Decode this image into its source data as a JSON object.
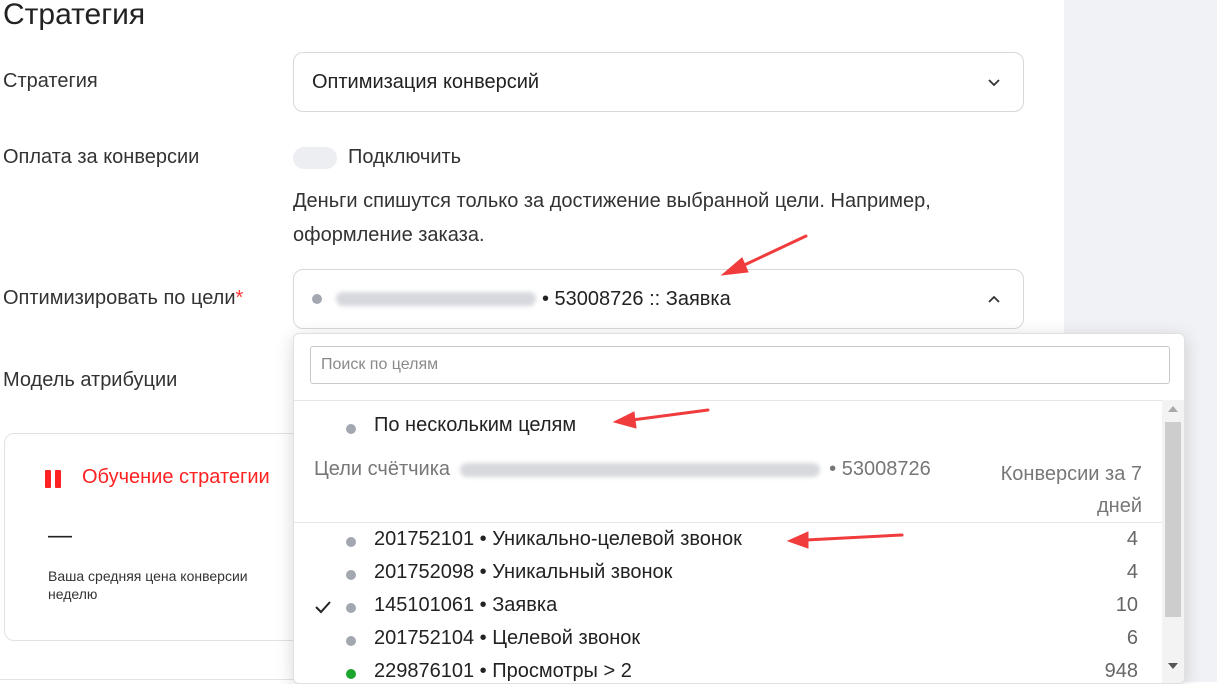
{
  "page_title": "Стратегия",
  "strategy": {
    "label": "Стратегия",
    "value": "Оптимизация конверсий"
  },
  "conversion_payment": {
    "label": "Оплата за конверсии",
    "toggle_label": "Подключить",
    "hint": "Деньги спишутся только за достижение выбранной цели. Например, оформление заказа."
  },
  "goal_select": {
    "label": "Оптимизировать по цели",
    "required_mark": "*",
    "selected_suffix": "• 53008726 :: Заявка"
  },
  "attribution": {
    "label": "Модель атрибуции"
  },
  "training": {
    "title": "Обучение стратегии",
    "dash": "—",
    "note": "Ваша средняя цена конверсии неделю"
  },
  "dropdown": {
    "search_placeholder": "Поиск по целям",
    "multi_goals": "По нескольким целям",
    "group_header_prefix": "Цели счётчика",
    "group_header_id": "• 53008726",
    "conversions_header": "Конверсии за 7 дней",
    "items": [
      {
        "text": "201752101 • Уникально-целевой звонок",
        "count": "4",
        "checked": false,
        "dot": "gray"
      },
      {
        "text": "201752098 • Уникальный звонок",
        "count": "4",
        "checked": false,
        "dot": "gray"
      },
      {
        "text": "145101061 • Заявка",
        "count": "10",
        "checked": true,
        "dot": "gray"
      },
      {
        "text": "201752104 • Целевой звонок",
        "count": "6",
        "checked": false,
        "dot": "gray"
      },
      {
        "text": "229876101 • Просмотры > 2",
        "count": "948",
        "checked": false,
        "dot": "green"
      }
    ]
  },
  "colors": {
    "accent_red": "#ff2222",
    "annotation_arrow": "#f03c3c",
    "green_dot": "#1ba52c",
    "gray_dot": "#a3a7b0",
    "side_panel": "#f1f2f5"
  }
}
